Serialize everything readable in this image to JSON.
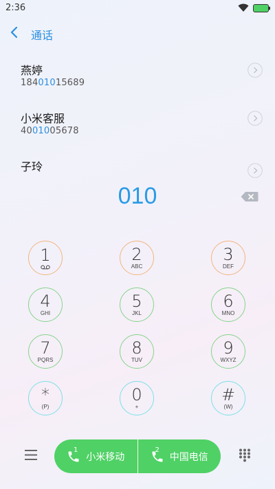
{
  "status_bar": {
    "time": "2:36",
    "icons": [
      "wifi-icon",
      "battery-icon"
    ]
  },
  "header": {
    "back_icon": "chevron-left-icon",
    "title": "通话"
  },
  "contacts": [
    {
      "name": "燕婷",
      "number_prefix": "184",
      "number_match": "010",
      "number_suffix": "15689"
    },
    {
      "name": "小米客服",
      "number_prefix": "40",
      "number_match": "010",
      "number_suffix": "05678"
    },
    {
      "name": "子玲",
      "number_prefix": "",
      "number_match": "",
      "number_suffix": ""
    }
  ],
  "dialer": {
    "input": "010",
    "keys": [
      {
        "digit": "1",
        "letters": ""
      },
      {
        "digit": "2",
        "letters": "ABC"
      },
      {
        "digit": "3",
        "letters": "DEF"
      },
      {
        "digit": "4",
        "letters": "GHI"
      },
      {
        "digit": "5",
        "letters": "JKL"
      },
      {
        "digit": "6",
        "letters": "MNO"
      },
      {
        "digit": "7",
        "letters": "PQRS"
      },
      {
        "digit": "8",
        "letters": "TUV"
      },
      {
        "digit": "9",
        "letters": "WXYZ"
      },
      {
        "digit": "*",
        "letters": "(P)"
      },
      {
        "digit": "0",
        "letters": "+"
      },
      {
        "digit": "#",
        "letters": "(W)"
      }
    ]
  },
  "bottom_bar": {
    "sim1": {
      "number": "1",
      "label": "小米移动"
    },
    "sim2": {
      "number": "2",
      "label": "中国电信"
    }
  },
  "colors": {
    "accent": "#2a8fe0",
    "call_green": "#4fd165",
    "key_ring_orange": "#f2b57e",
    "key_ring_green": "#86d48a",
    "key_ring_cyan": "#7ee0e6"
  }
}
